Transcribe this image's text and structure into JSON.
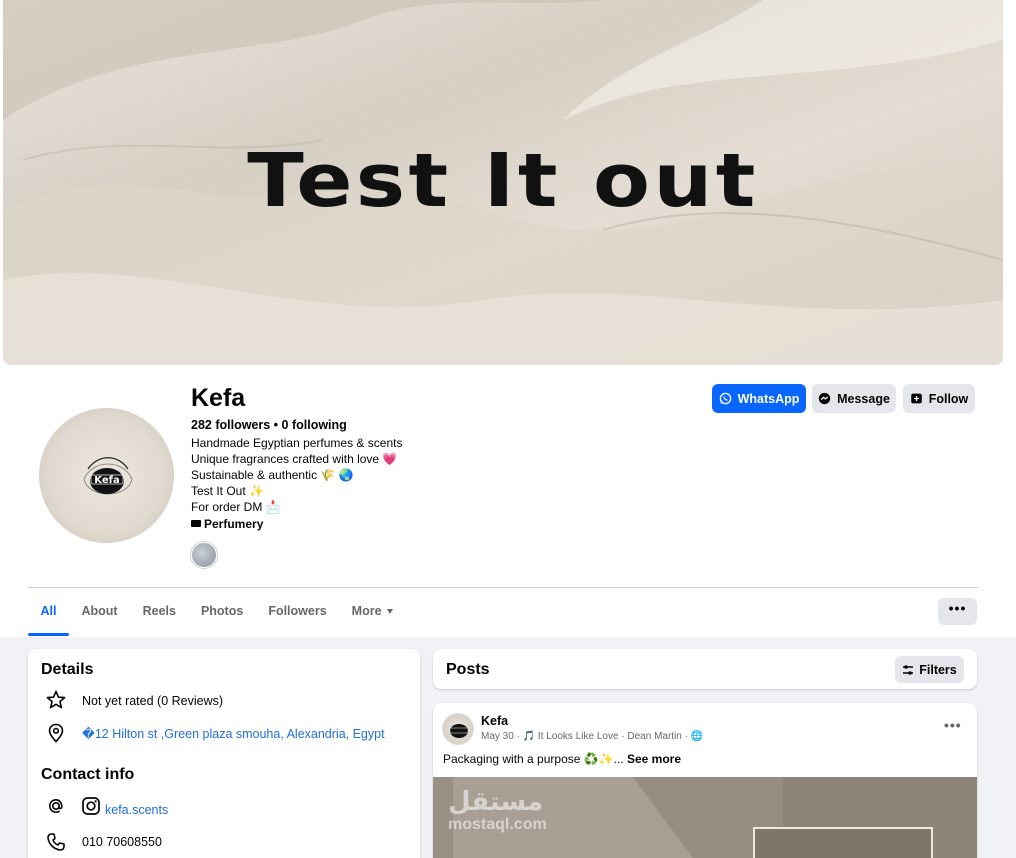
{
  "cover": {
    "title": "Test It out"
  },
  "profile": {
    "name": "Kefa",
    "avatar_text": "Kefa",
    "counts": "282 followers • 0 following",
    "bio": [
      "Handmade Egyptian perfumes & scents",
      "Unique fragrances crafted with love 💗",
      "Sustainable & authentic 🌾 🌏",
      "Test It Out ✨",
      "For order DM 📩"
    ],
    "category": "Perfumery"
  },
  "actions": {
    "whatsapp": "WhatsApp",
    "message": "Message",
    "follow": "Follow"
  },
  "tabs": [
    {
      "label": "All",
      "active": true
    },
    {
      "label": "About"
    },
    {
      "label": "Reels"
    },
    {
      "label": "Photos"
    },
    {
      "label": "Followers"
    },
    {
      "label": "More"
    }
  ],
  "more_dots": "•••",
  "details": {
    "title": "Details",
    "rating": "Not yet rated (0 Reviews)",
    "address": "�12 Hilton st ,Green plaza smouha, Alexandria, Egypt",
    "contact_title": "Contact info",
    "instagram": "kefa.scents",
    "phone": "010 70608550"
  },
  "posts": {
    "title": "Posts",
    "filters": "Filters",
    "post": {
      "author": "Kefa",
      "meta": "May 30 · 🎵 It Looks Like Love · Dean Martin · 🌐",
      "text": "Packaging with a purpose ♻️✨...",
      "see_more": "See more",
      "dots": "•••"
    }
  },
  "watermark": {
    "ar": "مستقل",
    "en": "mostaql.com"
  },
  "colors": {
    "accent": "#0866ff",
    "link": "#216fdb",
    "button_gray": "#e4e6eb",
    "background": "#f0f2f5"
  }
}
